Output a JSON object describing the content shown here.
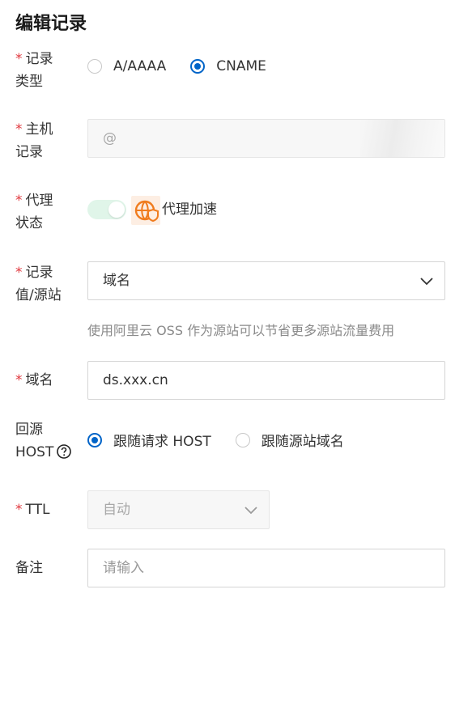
{
  "title": "编辑记录",
  "record_type": {
    "label_line1": "记录",
    "label_line2": "类型",
    "options": [
      {
        "label": "A/AAAA",
        "checked": false
      },
      {
        "label": "CNAME",
        "checked": true
      }
    ]
  },
  "host_record": {
    "label_line1": "主机",
    "label_line2": "记录",
    "placeholder": "@"
  },
  "proxy_status": {
    "label_line1": "代理",
    "label_line2": "状态",
    "enabled": true,
    "text": "代理加速"
  },
  "record_value": {
    "label_line1": "记录",
    "label_line2": "值/源站",
    "selected": "域名",
    "hint": "使用阿里云 OSS 作为源站可以节省更多源站流量费用"
  },
  "domain": {
    "label": "域名",
    "value": "ds.xxx.cn"
  },
  "back_to_origin_host": {
    "label_line1": "回源",
    "label_line2": "HOST",
    "options": [
      {
        "label": "跟随请求 HOST",
        "checked": true
      },
      {
        "label": "跟随源站域名",
        "checked": false
      }
    ]
  },
  "ttl": {
    "label": "TTL",
    "selected": "自动"
  },
  "remark": {
    "label": "备注",
    "placeholder": "请输入"
  },
  "colors": {
    "primary": "#0064c8",
    "required": "#e0383e",
    "toggle_bg": "#e0f5e9",
    "proxy_icon": "#f07c1e"
  }
}
